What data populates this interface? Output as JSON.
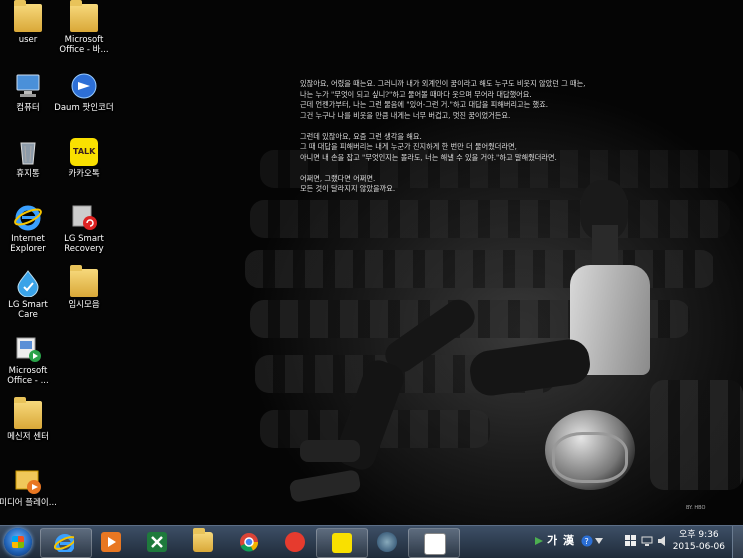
{
  "desktop": {
    "poem": [
      "있잖아요, 어렸을 때는요. 그러니까 내가 외계인이 꿈이라고 해도 누구도 비웃지 않았던 그 때는,",
      "나는 누가 \"무엇이 되고 싶니?\"하고 물어볼 때마다 웃으며 무어라 대답했어요.",
      "근데 언젠가부터, 나는 그런 물음에 \"있어-그런 거.\"하고 대답을 피해버리고는 했죠.",
      "그건 누구나 나를 비웃을 만큼 내게는 너무 버겁고, 멋진 꿈이었거든요.",
      "",
      "그런데 있잖아요, 요즘 그런 생각을 해요.",
      "그 때 대답을 피해버리는 내게 누군가 진지하게 한 번만 더 물어줬더라면,",
      "아니면 내 손을 잡고 \"무엇인지는 몰라도, 너는 해낼 수 있을 거야.\"하고 말해줬더라면.",
      "",
      "어쩌면, 그랬다면 어쩌면.",
      "모든 것이 달라지지 않았을까요."
    ],
    "credit": "BY. HBO",
    "icons": [
      {
        "label": "user",
        "name": "user-folder-icon"
      },
      {
        "label": "Microsoft Office - 바...",
        "name": "ms-office-shortcut-icon"
      },
      {
        "label": "컴퓨터",
        "name": "computer-icon"
      },
      {
        "label": "Daum 팟인코더",
        "name": "daum-encoder-icon"
      },
      {
        "label": "휴지통",
        "name": "recycle-bin-icon"
      },
      {
        "label": "카카오톡",
        "name": "kakaotalk-icon"
      },
      {
        "label": "Internet Explorer",
        "name": "internet-explorer-icon"
      },
      {
        "label": "LG Smart Recovery",
        "name": "lg-smart-recovery-icon"
      },
      {
        "label": "LG Smart Care",
        "name": "lg-smart-care-icon"
      },
      {
        "label": "임시모음",
        "name": "temp-folder-icon"
      },
      {
        "label": "Microsoft Office - ...",
        "name": "ms-office-shortcut-2-icon"
      },
      {
        "label": "메신저 센터",
        "name": "messenger-center-icon"
      },
      {
        "label": "미디어 플레이...",
        "name": "media-player-icon"
      }
    ]
  },
  "taskbar": {
    "start": "start-orb",
    "kakao_glyph": "TALK",
    "ime": {
      "lang": "가",
      "hanja": "漢"
    },
    "clock": {
      "time": "오후 9:36",
      "date": "2015-06-06"
    },
    "colors": {
      "bar": "#2b3a4d",
      "accent": "#1d5fb3"
    }
  }
}
